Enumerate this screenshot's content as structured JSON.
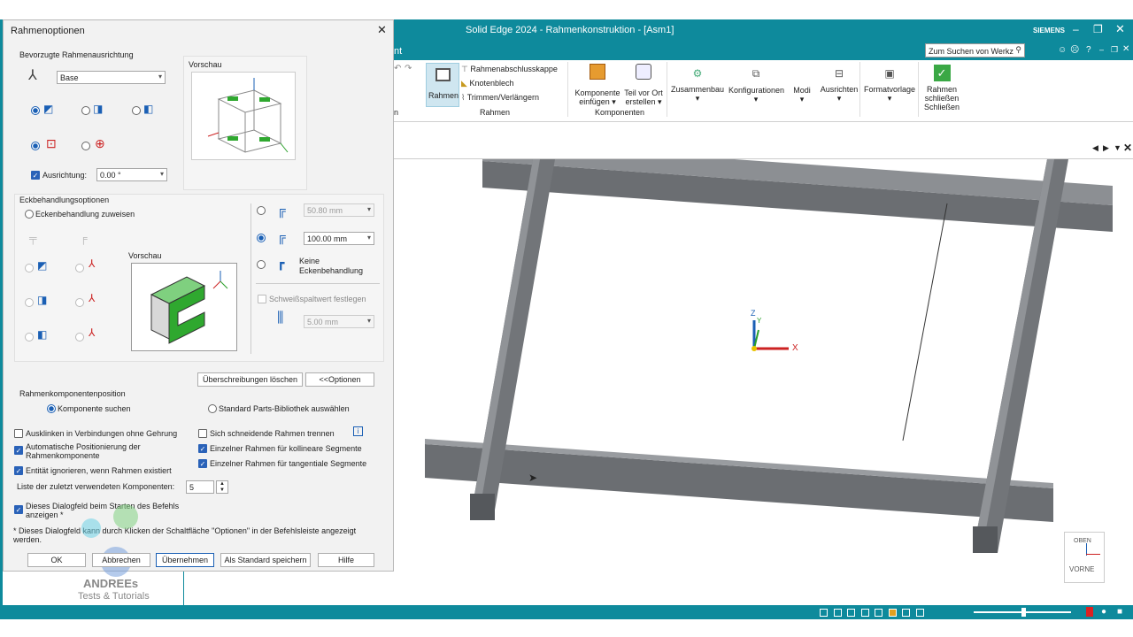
{
  "window": {
    "title": "Solid Edge 2024 - Rahmenkonstruktion - [Asm1]",
    "brand": "SIEMENS",
    "search_placeholder": "Zum Suchen von Werkz",
    "tab_fragment": "nt"
  },
  "ribbon": {
    "rahmen_group": {
      "rahmen_label": "Rahmen",
      "items": [
        "Rahmenabschlusskappe",
        "Knotenblech",
        "Trimmen/Verlängern"
      ],
      "group_label": "Rahmen"
    },
    "komponenten_group": {
      "komponente_line1": "Komponente",
      "komponente_line2": "einfügen",
      "teil_line1": "Teil vor Ort",
      "teil_line2": "erstellen",
      "group_label": "Komponenten"
    },
    "buttons": [
      "Zusammenbau",
      "Konfigurationen",
      "Modi",
      "Ausrichten",
      "Formatvorlage"
    ],
    "close_line1": "Rahmen",
    "close_line2": "schließen",
    "close_group": "Schließen",
    "left_fragment": "n"
  },
  "dialog": {
    "title": "Rahmenoptionen",
    "orientation_section": "Bevorzugte Rahmenausrichtung",
    "orientation_select": "Base",
    "preview_label": "Vorschau",
    "alignment_label": "Ausrichtung:",
    "alignment_value": "0.00 °",
    "corner_section": "Eckbehandlungsoptionen",
    "corner_assign": "Eckenbehandlung zuweisen",
    "preview2_label": "Vorschau",
    "corner_value1": "50.80 mm",
    "corner_value2": "100.00 mm",
    "no_corner_line1": "Keine",
    "no_corner_line2": "Eckenbehandlung",
    "weld_gap": "Schweißspaltwert festlegen",
    "weld_value": "5.00 mm",
    "btn_clear": "Überschreibungen löschen",
    "btn_options": "<<Optionen",
    "position_section": "Rahmenkomponentenposition",
    "radio_find": "Komponente suchen",
    "radio_library": "Standard Parts-Bibliothek auswählen",
    "chk_unlink": "Ausklinken in Verbindungen ohne Gehrung",
    "chk_auto_line1": "Automatische Positionierung der",
    "chk_auto_line2": "Rahmenkomponente",
    "chk_ignore": "Entität ignorieren, wenn Rahmen existiert",
    "chk_separate": "Sich schneidende Rahmen trennen",
    "chk_collinear": "Einzelner Rahmen für kollineare Segmente",
    "chk_tangent": "Einzelner Rahmen für tangentiale Segmente",
    "recent_label": "Liste der zuletzt verwendeten Komponenten:",
    "recent_value": "5",
    "chk_show_line1": "Dieses Dialogfeld beim Starten des Befehls",
    "chk_show_line2": "anzeigen *",
    "note_line1": "* Dieses Dialogfeld kann durch Klicken der Schaltfläche \"Optionen\" in der Befehlsleiste angezeigt",
    "note_line2": "werden.",
    "btn_ok": "OK",
    "btn_cancel": "Abbrechen",
    "btn_apply": "Übernehmen",
    "btn_default": "Als Standard speichern",
    "btn_help": "Hilfe"
  },
  "watermark": {
    "line1": "ANDREEs",
    "line2": "Tests & Tutorials"
  },
  "viewport": {
    "axis_z": "Z",
    "axis_y": "Y",
    "axis_x": "X",
    "cube_top": "OBEN",
    "cube_front": "VORNE"
  },
  "colors": {
    "accent": "#0e8a9c",
    "selection_blue": "#1a5fb4",
    "frame_gray": "#6b6e72"
  }
}
